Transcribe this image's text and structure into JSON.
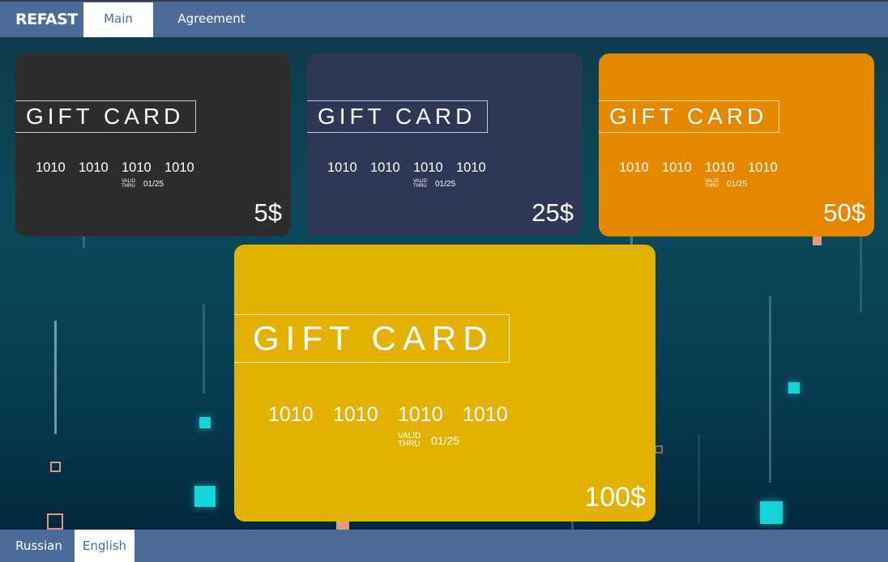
{
  "header": {
    "brand": "REFAST",
    "tabs": [
      {
        "label": "Main",
        "active": true
      },
      {
        "label": "Agreement",
        "active": false
      }
    ]
  },
  "cards": [
    {
      "title": "GIFT CARD",
      "numbers": [
        "1010",
        "1010",
        "1010",
        "1010"
      ],
      "valid_label_1": "VALID",
      "valid_label_2": "THRU",
      "expiry": "01/25",
      "price": "5$",
      "color": "#2f2d2b"
    },
    {
      "title": "GIFT CARD",
      "numbers": [
        "1010",
        "1010",
        "1010",
        "1010"
      ],
      "valid_label_1": "VALID",
      "valid_label_2": "THRU",
      "expiry": "01/25",
      "price": "25$",
      "color": "#2d3756"
    },
    {
      "title": "GIFT CARD",
      "numbers": [
        "1010",
        "1010",
        "1010",
        "1010"
      ],
      "valid_label_1": "VALID",
      "valid_label_2": "THRU",
      "expiry": "01/25",
      "price": "50$",
      "color": "#e58800"
    },
    {
      "title": "GIFT CARD",
      "numbers": [
        "1010",
        "1010",
        "1010",
        "1010"
      ],
      "valid_label_1": "VALID",
      "valid_label_2": "THRU",
      "expiry": "01/25",
      "price": "100$",
      "color": "#e3b201"
    }
  ],
  "footer": {
    "languages": [
      {
        "label": "Russian",
        "active": false
      },
      {
        "label": "English",
        "active": true
      }
    ]
  },
  "colors": {
    "nav": "#4d6b98",
    "accent_cyan": "#14d4d8",
    "accent_peach": "#e89a7c"
  }
}
